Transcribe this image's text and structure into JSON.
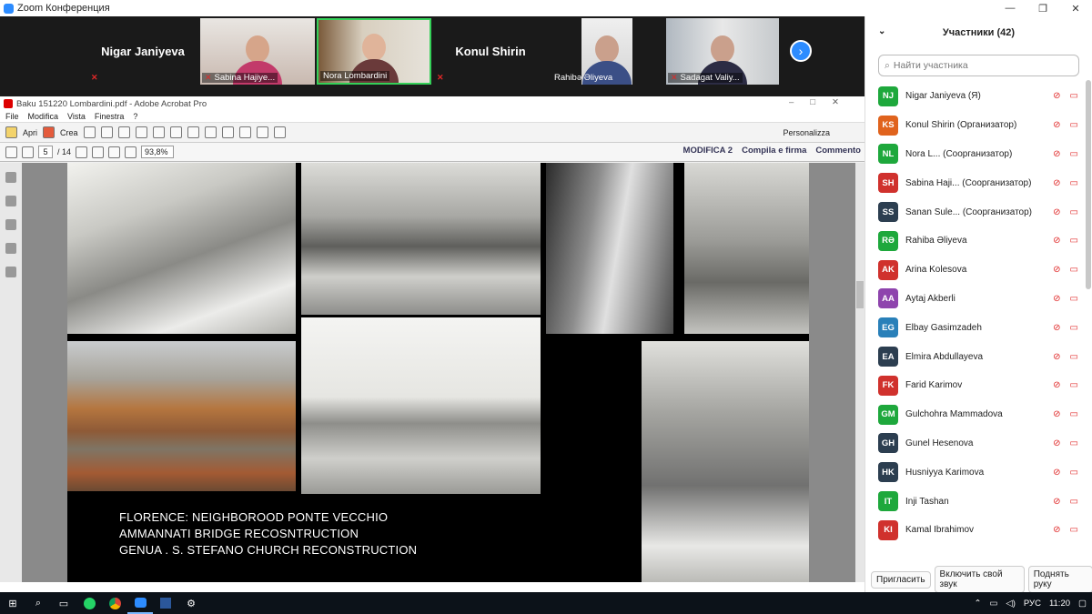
{
  "window": {
    "title": "Zoom Конференция"
  },
  "gallery": {
    "tiles": [
      {
        "name": "Nigar Janiyeva",
        "type": "name"
      },
      {
        "name": "Sabina Hajiye...",
        "type": "video"
      },
      {
        "name": "Nora Lombardini",
        "type": "video"
      },
      {
        "name": "Konul Shirin",
        "type": "name"
      },
      {
        "name": "Rahibə Əliyeva",
        "type": "video"
      },
      {
        "name": "Sadagat Valiy...",
        "type": "video"
      }
    ],
    "next_icon": "›"
  },
  "acrobat": {
    "title": "Baku 151220 Lombardini.pdf - Adobe Acrobat Pro",
    "menu": [
      "File",
      "Modifica",
      "Vista",
      "Finestra",
      "?"
    ],
    "tool_apri": "Apri",
    "tool_crea": "Crea",
    "personalizza": "Personalizza",
    "page_current": "5",
    "page_total": "/ 14",
    "zoom": "93,8%",
    "links": [
      "MODIFICA 2",
      "Compila e firma",
      "Commento"
    ]
  },
  "slide": {
    "captions": [
      "FLORENCE: NEIGHBOROOD PONTE VECCHIO",
      "AMMANNATI BRIDGE RECOSNTRUCTION",
      "GENUA . S. STEFANO CHURCH RECONSTRUCTION"
    ]
  },
  "participants": {
    "header": "Участники (42)",
    "search_placeholder": "Найти участника",
    "list": [
      {
        "initials": "NJ",
        "name": "Nigar Janiyeva (Я)",
        "color": "#1ea83c"
      },
      {
        "initials": "KS",
        "name": "Konul Shirin (Организатор)",
        "color": "#e0631d"
      },
      {
        "initials": "NL",
        "name": "Nora L... (Соорганизатор)",
        "color": "#1ea83c"
      },
      {
        "initials": "SH",
        "name": "Sabina Haji... (Соорганизатор)",
        "color": "#d0312d"
      },
      {
        "initials": "SS",
        "name": "Sanan Sule... (Соорганизатор)",
        "color": "#2c3e50"
      },
      {
        "initials": "RƏ",
        "name": "Rahiba Əliyeva",
        "color": "#1ea83c"
      },
      {
        "initials": "AK",
        "name": "Arina Kolesova",
        "color": "#d0312d"
      },
      {
        "initials": "AA",
        "name": "Aytaj Akberli",
        "color": "#8e44ad"
      },
      {
        "initials": "EG",
        "name": "Elbay Gasimzadeh",
        "color": "#2980b9"
      },
      {
        "initials": "EA",
        "name": "Elmira Abdullayeva",
        "color": "#2c3e50"
      },
      {
        "initials": "FK",
        "name": "Farid Karimov",
        "color": "#d0312d"
      },
      {
        "initials": "GM",
        "name": "Gulchohra Mammadova",
        "color": "#1ea83c"
      },
      {
        "initials": "GH",
        "name": "Gunel Hesenova",
        "color": "#2c3e50"
      },
      {
        "initials": "HK",
        "name": "Husniyya Karimova",
        "color": "#2c3e50"
      },
      {
        "initials": "IT",
        "name": "Inji Tashan",
        "color": "#1ea83c"
      },
      {
        "initials": "KI",
        "name": "Kamal Ibrahimov",
        "color": "#d0312d"
      }
    ],
    "footer": [
      "Пригласить",
      "Включить свой звук",
      "Поднять руку"
    ]
  },
  "taskbar": {
    "lang": "РУС",
    "time": "11:20"
  }
}
